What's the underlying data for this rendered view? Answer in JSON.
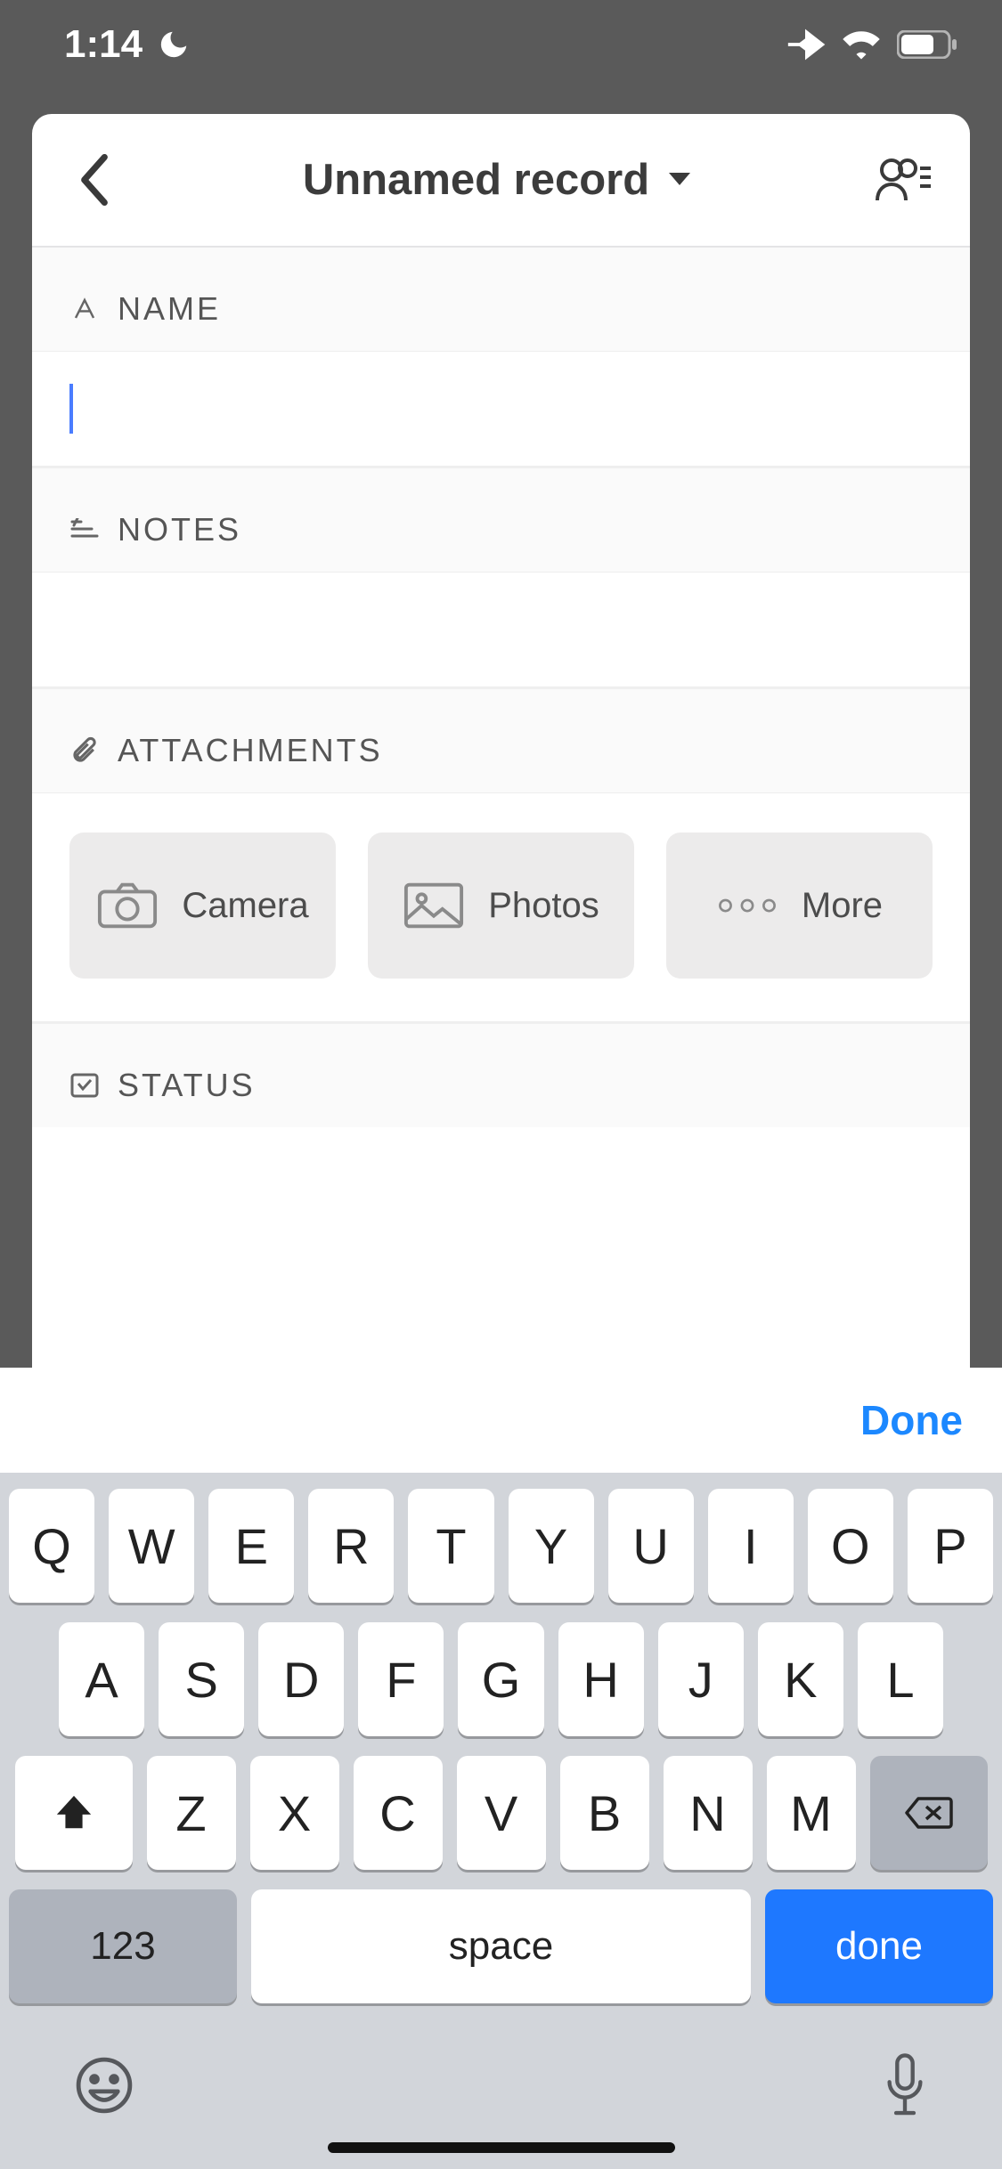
{
  "status": {
    "time": "1:14"
  },
  "header": {
    "title": "Unnamed record"
  },
  "fields": {
    "name": {
      "label": "NAME",
      "value": ""
    },
    "notes": {
      "label": "NOTES",
      "value": ""
    },
    "attachments": {
      "label": "ATTACHMENTS",
      "buttons": {
        "camera": "Camera",
        "photos": "Photos",
        "more": "More"
      }
    },
    "status": {
      "label": "STATUS"
    }
  },
  "keyboard": {
    "done": "Done",
    "row1": [
      "Q",
      "W",
      "E",
      "R",
      "T",
      "Y",
      "U",
      "I",
      "O",
      "P"
    ],
    "row2": [
      "A",
      "S",
      "D",
      "F",
      "G",
      "H",
      "J",
      "K",
      "L"
    ],
    "row3": [
      "Z",
      "X",
      "C",
      "V",
      "B",
      "N",
      "M"
    ],
    "numbers": "123",
    "space": "space",
    "enter": "done"
  }
}
